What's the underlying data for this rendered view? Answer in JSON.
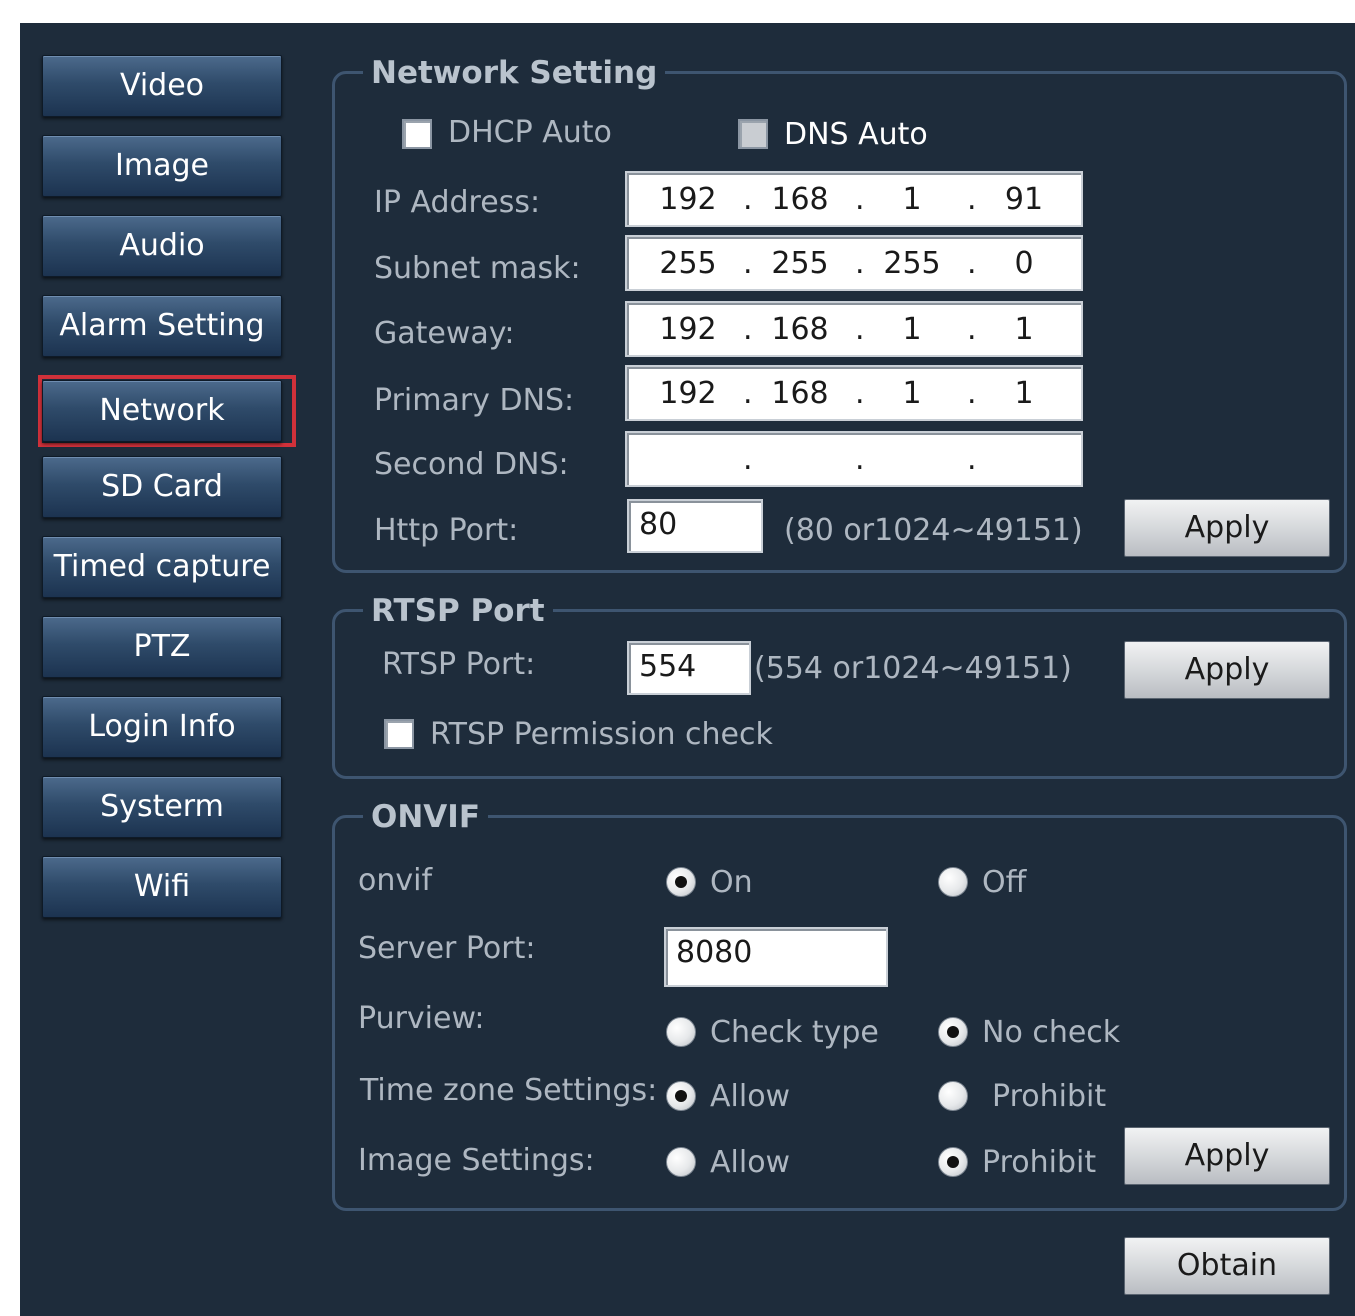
{
  "sidebar": {
    "items": [
      {
        "label": "Video"
      },
      {
        "label": "Image"
      },
      {
        "label": "Audio"
      },
      {
        "label": "Alarm Setting"
      },
      {
        "label": "Network",
        "selected": true
      },
      {
        "label": "SD Card"
      },
      {
        "label": "Timed capture"
      },
      {
        "label": "PTZ"
      },
      {
        "label": "Login Info"
      },
      {
        "label": "Systerm"
      },
      {
        "label": "Wifi"
      }
    ]
  },
  "network": {
    "title": "Network Setting",
    "dhcp_auto": {
      "label": "DHCP Auto",
      "checked": false
    },
    "dns_auto": {
      "label": "DNS Auto",
      "checked": false
    },
    "ip_address": {
      "label": "IP Address:",
      "octets": [
        "192",
        "168",
        "1",
        "91"
      ]
    },
    "subnet_mask": {
      "label": "Subnet mask:",
      "octets": [
        "255",
        "255",
        "255",
        "0"
      ]
    },
    "gateway": {
      "label": "Gateway:",
      "octets": [
        "192",
        "168",
        "1",
        "1"
      ]
    },
    "primary_dns": {
      "label": "Primary DNS:",
      "octets": [
        "192",
        "168",
        "1",
        "1"
      ]
    },
    "second_dns": {
      "label": "Second DNS:",
      "octets": [
        "",
        "",
        "",
        ""
      ]
    },
    "http_port": {
      "label": "Http Port:",
      "value": "80",
      "hint": "(80 or1024~49151)"
    },
    "apply_label": "Apply"
  },
  "rtsp": {
    "title": "RTSP Port",
    "port": {
      "label": "RTSP Port:",
      "value": "554",
      "hint": "(554 or1024~49151)"
    },
    "permission_check": {
      "label": "RTSP Permission check",
      "checked": false
    },
    "apply_label": "Apply"
  },
  "onvif": {
    "title": "ONVIF",
    "onvif_row": {
      "label": "onvif",
      "option_a": "On",
      "option_b": "Off",
      "selected": "On"
    },
    "server_port": {
      "label": "Server Port:",
      "value": "8080"
    },
    "purview": {
      "label": "Purview:",
      "option_a": "Check type",
      "option_b": "No check",
      "selected": "No check"
    },
    "time_zone": {
      "label": "Time zone Settings:",
      "option_a": "Allow",
      "option_b": "Prohibit",
      "selected": "Allow"
    },
    "image_settings": {
      "label": "Image Settings:",
      "option_a": "Allow",
      "option_b": "Prohibit",
      "selected": "Prohibit"
    },
    "apply_label": "Apply"
  },
  "obtain_label": "Obtain",
  "colors": {
    "panel_bg": "#1e2c3b",
    "nav_button": "#2f4b6a",
    "selection_frame": "#d0313a",
    "label_text": "#aeb7c1"
  }
}
